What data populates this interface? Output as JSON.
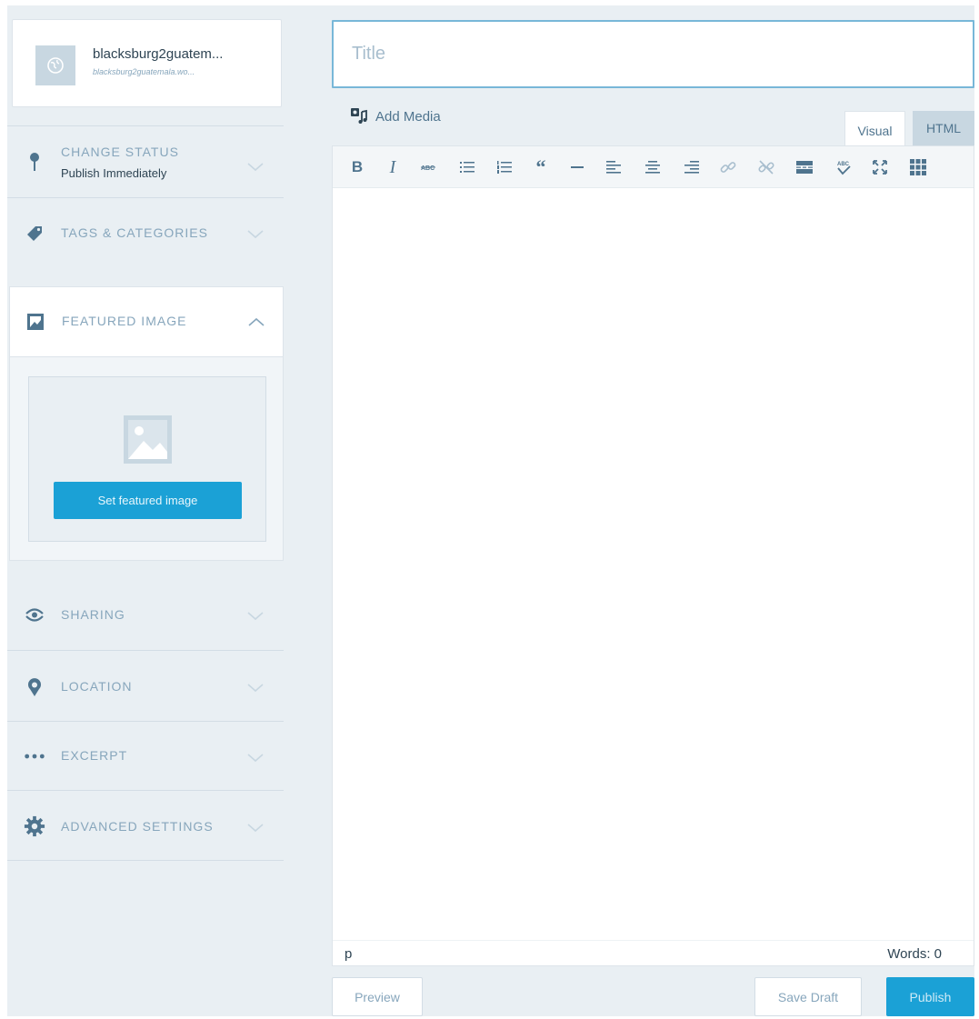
{
  "site": {
    "title": "blacksburg2guatem...",
    "url": "blacksburg2guatemala.wo..."
  },
  "sidebar": {
    "status": {
      "label": "CHANGE STATUS",
      "value": "Publish Immediately"
    },
    "tags": {
      "label": "TAGS & CATEGORIES"
    },
    "featured": {
      "label": "FEATURED IMAGE",
      "button": "Set featured image"
    },
    "sharing": {
      "label": "SHARING"
    },
    "location": {
      "label": "LOCATION"
    },
    "excerpt": {
      "label": "EXCERPT"
    },
    "advanced": {
      "label": "ADVANCED SETTINGS"
    }
  },
  "editor": {
    "title_placeholder": "Title",
    "add_media": "Add Media",
    "tabs": {
      "visual": "Visual",
      "html": "HTML"
    },
    "path": "p",
    "words": "Words: 0"
  },
  "actions": {
    "preview": "Preview",
    "save_draft": "Save Draft",
    "publish": "Publish"
  },
  "colors": {
    "accent": "#1ba1d6",
    "background": "#e9eff3",
    "muted": "#87a6bc"
  }
}
